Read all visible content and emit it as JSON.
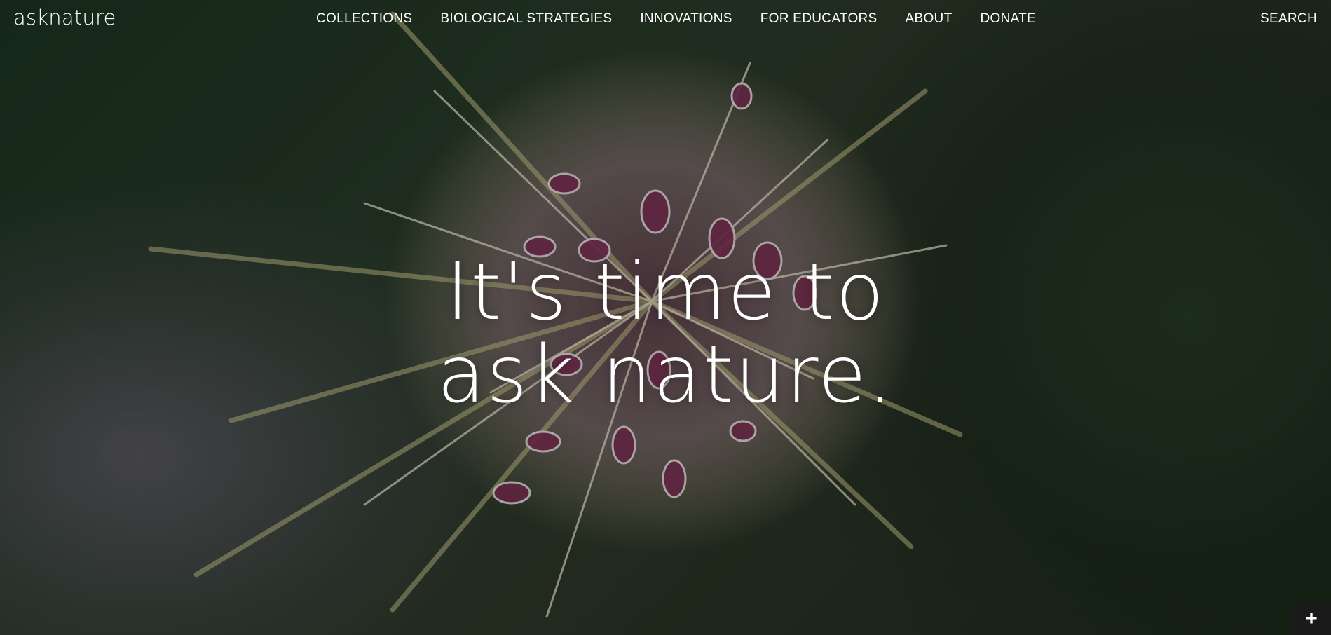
{
  "brand": {
    "logo_text": "asknature"
  },
  "nav": {
    "items": [
      {
        "label": "COLLECTIONS"
      },
      {
        "label": "BIOLOGICAL STRATEGIES"
      },
      {
        "label": "INNOVATIONS"
      },
      {
        "label": "FOR EDUCATORS"
      },
      {
        "label": "ABOUT"
      },
      {
        "label": "DONATE"
      }
    ],
    "search_label": "SEARCH"
  },
  "hero": {
    "headline_line1": "It's time to",
    "headline_line2": "ask nature."
  },
  "corner_button": {
    "icon": "plus-icon",
    "glyph": "+"
  },
  "colors": {
    "text": "#ffffff",
    "corner_button_bg": "#1a1a1a"
  }
}
